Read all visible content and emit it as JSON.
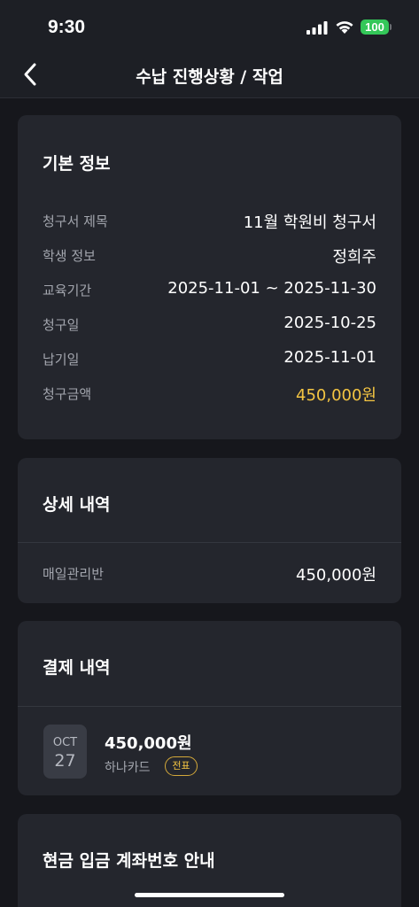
{
  "status_bar": {
    "time": "9:30",
    "battery": "100"
  },
  "nav": {
    "title": "수납 진행상황 / 작업"
  },
  "basic_info": {
    "title": "기본 정보",
    "rows": [
      {
        "label": "청구서 제목",
        "value": "11월 학원비 청구서"
      },
      {
        "label": "학생 정보",
        "value": "정희주"
      },
      {
        "label": "교육기간",
        "value": "2025-11-01 ~ 2025-11-30"
      },
      {
        "label": "청구일",
        "value": "2025-10-25"
      },
      {
        "label": "납기일",
        "value": "2025-11-01"
      },
      {
        "label": "청구금액",
        "value": "450,000원"
      }
    ]
  },
  "details": {
    "title": "상세 내역",
    "rows": [
      {
        "label": "매일관리반",
        "value": "450,000원"
      }
    ]
  },
  "payments": {
    "title": "결제 내역",
    "items": [
      {
        "month": "OCT",
        "day": "27",
        "amount": "450,000원",
        "method": "하나카드",
        "badge": "전표"
      }
    ]
  },
  "bank_guide": {
    "title": "현금 입금 계좌번호 안내"
  },
  "colors": {
    "background": "#16171c",
    "card": "#24262d",
    "accent": "#f4c542",
    "battery": "#34c759"
  },
  "icons": [
    "chevron-left-icon",
    "signal-icon",
    "wifi-icon",
    "battery-icon"
  ]
}
